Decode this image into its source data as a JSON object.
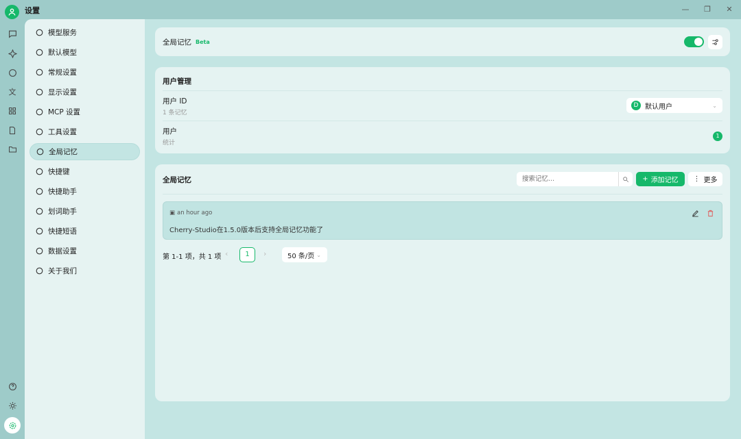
{
  "window": {
    "title": "设置"
  },
  "sidebar": {
    "items": [
      {
        "label": "模型服务",
        "icon": "cloud-icon"
      },
      {
        "label": "默认模型",
        "icon": "cube-icon"
      },
      {
        "label": "常规设置",
        "icon": "sliders-icon"
      },
      {
        "label": "显示设置",
        "icon": "monitor-icon"
      },
      {
        "label": "MCP 设置",
        "icon": "terminal-icon"
      },
      {
        "label": "工具设置",
        "icon": "tools-icon"
      },
      {
        "label": "全局记忆",
        "icon": "memory-icon"
      },
      {
        "label": "快捷键",
        "icon": "command-icon"
      },
      {
        "label": "快捷助手",
        "icon": "rocket-icon"
      },
      {
        "label": "划词助手",
        "icon": "text-select-icon"
      },
      {
        "label": "快捷短语",
        "icon": "zap-icon"
      },
      {
        "label": "数据设置",
        "icon": "hard-drive-icon"
      },
      {
        "label": "关于我们",
        "icon": "info-icon"
      }
    ]
  },
  "memory_toggle": {
    "label": "全局记忆",
    "badge": "Beta",
    "enabled": true
  },
  "user_mgmt": {
    "title": "用户管理",
    "user_id_label": "用户 ID",
    "user_id_sub": "1 条记忆",
    "selected_user": "默认用户",
    "user_avatar_letter": "D",
    "user_label": "用户",
    "user_sub": "统计",
    "user_count": "1"
  },
  "memories": {
    "title": "全局记忆",
    "search_placeholder": "搜索记忆...",
    "add_label": "添加记忆",
    "more_label": "更多",
    "items": [
      {
        "time": "an hour ago",
        "content": "Cherry-Studio在1.5.0版本后支持全局记忆功能了"
      }
    ],
    "pagination": {
      "summary": "第 1-1 项，共 1 项",
      "current_page": "1",
      "page_size": "50 条/页"
    }
  },
  "colors": {
    "accent": "#16b86a"
  }
}
